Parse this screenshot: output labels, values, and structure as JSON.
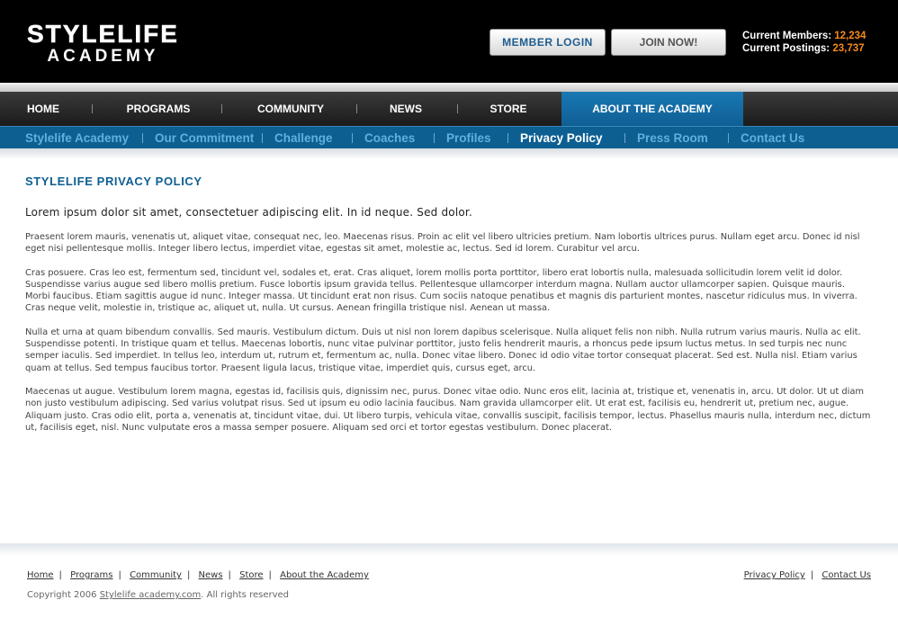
{
  "header": {
    "logo_line1": "STYLELIFE",
    "logo_line2": "ACADEMY",
    "login_label": "MEMBER LOGIN",
    "join_label": "JOIN NOW!",
    "members_label": "Current Members:",
    "members_value": "12,234",
    "postings_label": "Current Postings:",
    "postings_value": "23,737"
  },
  "main_nav": [
    {
      "label": "HOME"
    },
    {
      "label": "PROGRAMS"
    },
    {
      "label": "COMMUNITY"
    },
    {
      "label": "NEWS"
    },
    {
      "label": "STORE"
    },
    {
      "label": "ABOUT THE ACADEMY",
      "active": true
    }
  ],
  "sub_nav": [
    {
      "label": "Stylelife Academy"
    },
    {
      "label": "Our Commitment"
    },
    {
      "label": "Challenge"
    },
    {
      "label": "Coaches"
    },
    {
      "label": "Profiles"
    },
    {
      "label": "Privacy Policy",
      "active": true
    },
    {
      "label": "Press Room"
    },
    {
      "label": "Contact Us"
    }
  ],
  "content": {
    "title": "STYLELIFE PRIVACY POLICY",
    "lead": "Lorem ipsum dolor sit amet, consectetuer adipiscing elit. In id neque. Sed dolor.",
    "paragraphs": [
      "Praesent lorem mauris, venenatis ut, aliquet vitae, consequat nec, leo. Maecenas risus. Proin ac elit vel libero ultricies pretium. Nam lobortis ultrices purus. Nullam eget arcu. Donec id nisl eget nisi pellentesque mollis. Integer libero lectus, imperdiet vitae, egestas sit amet, molestie ac, lectus. Sed id lorem. Curabitur vel arcu.",
      "Cras posuere. Cras leo est, fermentum sed, tincidunt vel, sodales et, erat. Cras aliquet, lorem mollis porta porttitor, libero erat lobortis nulla, malesuada sollicitudin lorem velit id dolor. Suspendisse varius augue sed libero mollis pretium. Fusce lobortis ipsum gravida tellus. Pellentesque ullamcorper interdum magna. Nullam auctor ullamcorper sapien. Quisque mauris. Morbi faucibus. Etiam sagittis augue id nunc. Integer massa. Ut tincidunt erat non risus. Cum sociis natoque penatibus et magnis dis parturient montes, nascetur ridiculus mus. In viverra. Cras neque velit, molestie in, tristique ac, aliquet ut, nulla. Ut cursus. Aenean fringilla tristique nisl. Aenean ut massa.",
      "Nulla et urna at quam bibendum convallis. Sed mauris. Vestibulum dictum. Duis ut nisl non lorem dapibus scelerisque. Nulla aliquet felis non nibh. Nulla rutrum varius mauris. Nulla ac elit. Suspendisse potenti. In tristique quam et tellus. Maecenas lobortis, nunc vitae pulvinar porttitor, justo felis hendrerit mauris, a rhoncus pede ipsum luctus metus. In sed turpis nec nunc semper iaculis. Sed imperdiet. In tellus leo, interdum ut, rutrum et, fermentum ac, nulla. Donec vitae libero. Donec id odio vitae tortor consequat placerat. Sed est. Nulla nisl. Etiam varius quam at tellus. Sed tempus faucibus tortor. Praesent ligula lacus, tristique vitae, imperdiet quis, cursus eget, arcu.",
      "Maecenas ut augue. Vestibulum lorem magna, egestas id, facilisis quis, dignissim nec, purus. Donec vitae odio. Nunc eros elit, lacinia at, tristique et, venenatis in, arcu. Ut dolor. Ut ut diam non justo vestibulum adipiscing. Sed varius volutpat risus. Sed ut ipsum eu odio lacinia faucibus. Nam gravida ullamcorper elit. Ut erat est, facilisis eu, hendrerit ut, pretium nec, augue. Aliquam justo. Cras odio elit, porta a, venenatis at, tincidunt vitae, dui. Ut libero turpis, vehicula vitae, convallis suscipit, facilisis tempor, lectus. Phasellus mauris nulla, interdum nec, dictum ut, facilisis eget, nisl. Nunc vulputate eros a massa semper posuere. Aliquam sed orci et tortor egestas vestibulum. Donec placerat."
    ]
  },
  "footer": {
    "links": [
      "Home",
      "Programs",
      "Community",
      "News",
      "Store",
      "About the Academy"
    ],
    "right_links": [
      "Privacy Policy",
      "Contact Us"
    ],
    "separator": "|",
    "copyright_prefix": "Copyright 2006",
    "copyright_link": "Stylelife academy.com",
    "copyright_suffix": ".  All rights reserved"
  },
  "colors": {
    "brand_blue": "#0d5f92",
    "accent_orange": "#f68a1f",
    "header_black": "#000000"
  }
}
